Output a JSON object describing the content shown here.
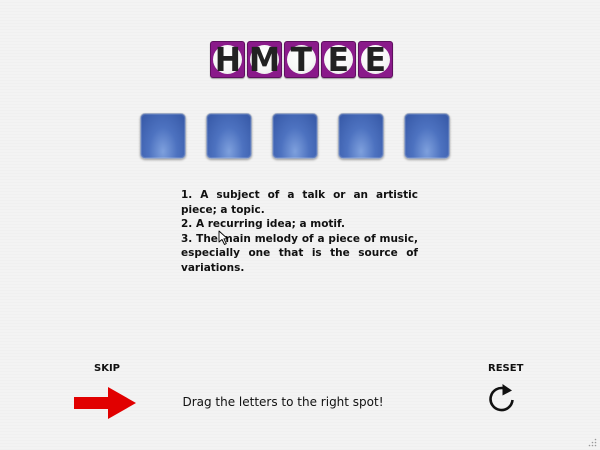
{
  "game": {
    "scrambled_letters": [
      "H",
      "M",
      "T",
      "E",
      "E"
    ],
    "answer_slot_count": 5,
    "definitions": [
      "1. A subject of a talk or an artistic piece; a topic.",
      "2. A recurring idea; a motif.",
      "3. The main melody of a piece of music, especially one that is the source of variations."
    ],
    "instruction": "Drag the letters to the right spot!"
  },
  "controls": {
    "skip_label": "SKIP",
    "reset_label": "RESET"
  },
  "icons": {
    "skip": "right-arrow-icon",
    "reset": "refresh-icon"
  },
  "colors": {
    "letter_tile": "#8a1a8a",
    "slot": "#4d72c0",
    "arrow": "#e00000"
  }
}
